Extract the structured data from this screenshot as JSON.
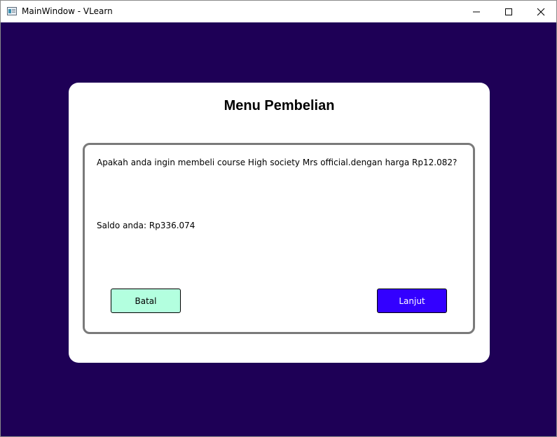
{
  "window": {
    "title": "MainWindow - VLearn",
    "app_icon": "app-window-icon",
    "controls": {
      "minimize_icon": "minimize-icon",
      "maximize_icon": "maximize-icon",
      "close_icon": "close-icon"
    }
  },
  "dialog": {
    "title": "Menu Pembelian",
    "question": "Apakah anda ingin membeli course High society Mrs official.dengan harga Rp12.082?",
    "balance": "Saldo anda: Rp336.074",
    "buttons": {
      "cancel_label": "Batal",
      "continue_label": "Lanjut"
    }
  },
  "colors": {
    "background": "#1e0056",
    "cancel_button": "#b3ffdf",
    "continue_button": "#3300ff"
  }
}
